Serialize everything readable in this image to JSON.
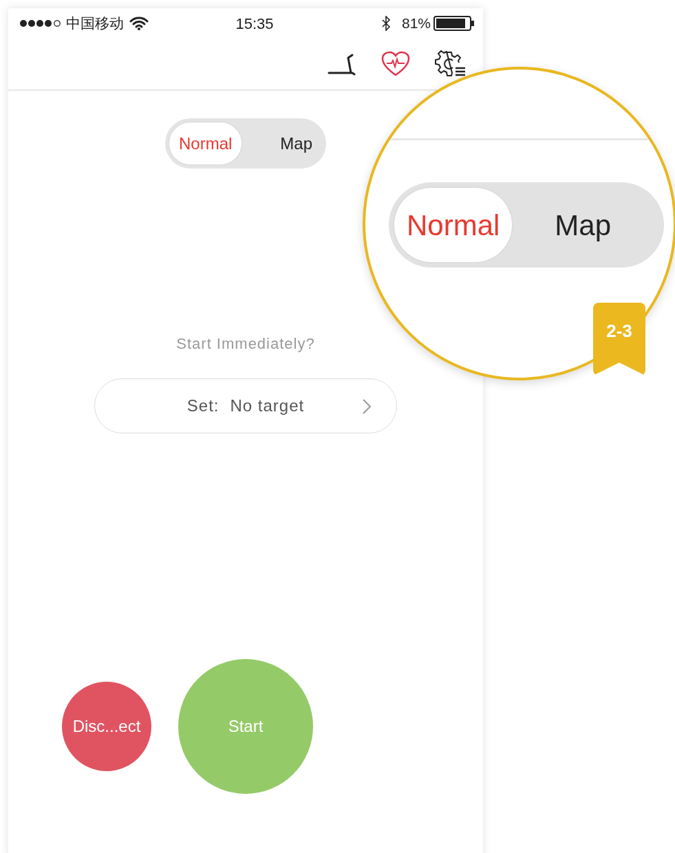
{
  "status_bar": {
    "carrier": "中国移动",
    "time": "15:35",
    "battery": "81%"
  },
  "mode_toggle": {
    "options": [
      {
        "label": "Normal",
        "selected": true
      },
      {
        "label": "Map",
        "selected": false
      }
    ]
  },
  "prompt": "Start Immediately?",
  "target_field": {
    "label": "Set:",
    "value": "No target"
  },
  "buttons": [
    {
      "label": "Disc...ect",
      "kind": "disconnect"
    },
    {
      "label": "Start",
      "kind": "start"
    }
  ],
  "callout": {
    "badge": "2-3",
    "options": [
      {
        "label": "Normal",
        "selected": true
      },
      {
        "label": "Map",
        "selected": false
      }
    ]
  }
}
